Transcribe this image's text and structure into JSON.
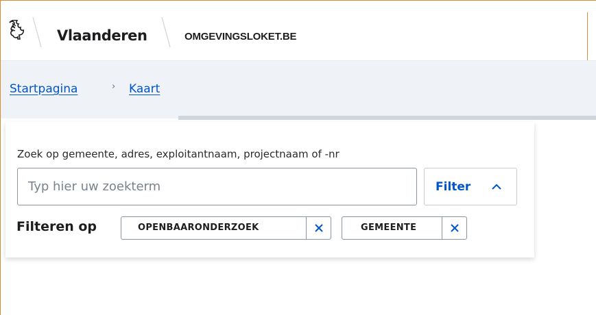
{
  "header": {
    "brand": "Vlaanderen",
    "site_name": "OMGEVINGSLOKET.BE",
    "logo_icon": "flemish-lion-icon"
  },
  "breadcrumb": {
    "items": [
      {
        "label": "Startpagina"
      },
      {
        "label": "Kaart"
      }
    ],
    "separator": "›"
  },
  "search": {
    "label": "Zoek op gemeente, adres, exploitantnaam, projectnaam of -nr",
    "placeholder": "Typ hier uw zoekterm",
    "value": "",
    "filter_button_label": "Filter",
    "filter_button_icon": "chevron-up-icon"
  },
  "filters": {
    "prefix": "Filteren op",
    "chips": [
      {
        "label": "OPENBAARONDERZOEK",
        "remove_icon": "close-icon"
      },
      {
        "label": "GEMEENTE",
        "remove_icon": "close-icon"
      }
    ]
  },
  "colors": {
    "accent": "#0055cc",
    "breadcrumb_bg": "#eff2f7",
    "frame_border": "#d88a3c"
  }
}
